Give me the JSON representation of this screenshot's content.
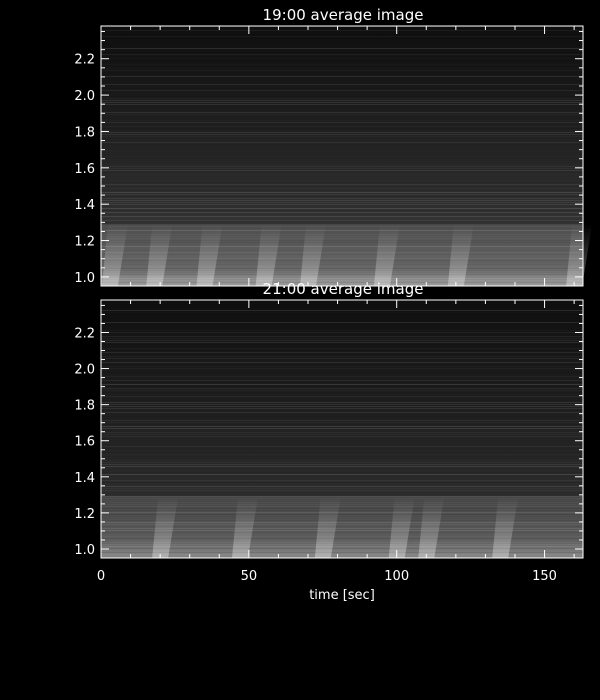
{
  "chart_data": [
    {
      "type": "heatmap",
      "title": "19:00 average image",
      "xlim": [
        0,
        163
      ],
      "ylim": [
        0.95,
        2.38
      ],
      "yticks": [
        "1.0",
        "1.2",
        "1.4",
        "1.6",
        "1.8",
        "2.0",
        "2.2"
      ],
      "ytick_values": [
        1.0,
        1.2,
        1.4,
        1.6,
        1.8,
        2.0,
        2.2
      ],
      "xlabel": "",
      "ylabel": "",
      "show_xtick_labels": false,
      "intensity_profile": {
        "below": [
          [
            0.95,
            0.62
          ],
          [
            1.05,
            0.4
          ],
          [
            1.2,
            0.34
          ],
          [
            1.29,
            0.3
          ]
        ],
        "above": [
          [
            1.29,
            0.2
          ],
          [
            1.5,
            0.17
          ],
          [
            1.8,
            0.13
          ],
          [
            2.1,
            0.09
          ],
          [
            2.38,
            0.06
          ]
        ]
      },
      "bright_columns": [
        3,
        18,
        35,
        55,
        70,
        95,
        120,
        160
      ]
    },
    {
      "type": "heatmap",
      "title": "21:00 average image",
      "xlim": [
        0,
        163
      ],
      "ylim": [
        0.95,
        2.38
      ],
      "yticks": [
        "1.0",
        "1.2",
        "1.4",
        "1.6",
        "1.8",
        "2.0",
        "2.2"
      ],
      "ytick_values": [
        1.0,
        1.2,
        1.4,
        1.6,
        1.8,
        2.0,
        2.2
      ],
      "xticks": [
        "0",
        "50",
        "100",
        "150"
      ],
      "xtick_values": [
        0,
        50,
        100,
        150
      ],
      "xlabel": "time [sec]",
      "ylabel": "",
      "show_xtick_labels": true,
      "intensity_profile": {
        "below": [
          [
            0.95,
            0.55
          ],
          [
            1.05,
            0.36
          ],
          [
            1.2,
            0.3
          ],
          [
            1.29,
            0.27
          ]
        ],
        "above": [
          [
            1.29,
            0.18
          ],
          [
            1.5,
            0.15
          ],
          [
            1.8,
            0.12
          ],
          [
            2.1,
            0.09
          ],
          [
            2.38,
            0.06
          ]
        ]
      },
      "bright_columns": [
        20,
        47,
        75,
        100,
        110,
        135
      ]
    }
  ]
}
